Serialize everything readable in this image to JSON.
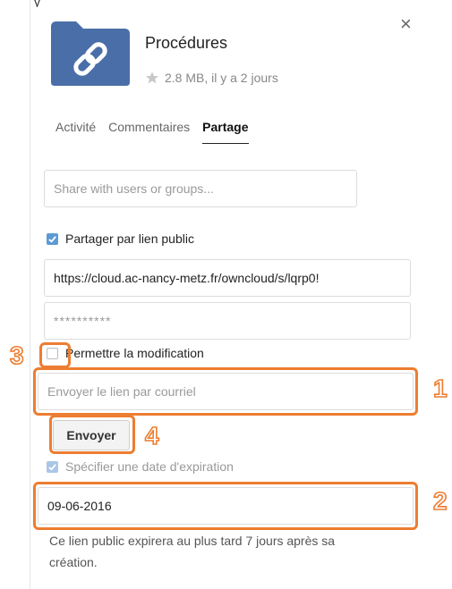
{
  "header": {
    "top_fragment": "y",
    "title": "Procédures",
    "meta": "2.8 MB, il y a 2 jours",
    "close_symbol": "×"
  },
  "tabs": [
    {
      "label": "Activité",
      "active": false
    },
    {
      "label": "Commentaires",
      "active": false
    },
    {
      "label": "Partage",
      "active": true
    }
  ],
  "share": {
    "search_placeholder": "Share with users or groups...",
    "public_link_label": "Partager par lien public",
    "public_link_checked": true,
    "link_url": "https://cloud.ac-nancy-metz.fr/owncloud/s/lqrp0!",
    "password_value": "**********",
    "allow_edit_label": "Permettre la modification",
    "allow_edit_checked": false,
    "email_placeholder": "Envoyer le lien par courriel",
    "send_label": "Envoyer",
    "expire_label": "Spécifier une date d'expiration",
    "expire_checked": true,
    "expire_date": "09-06-2016",
    "expire_note": "Ce lien public expirera au plus tard 7 jours après sa création."
  },
  "annotations": {
    "n1": "1",
    "n2": "2",
    "n3": "3",
    "n4": "4",
    "color": "#ed7d31"
  },
  "colors": {
    "folder": "#4a6ea8",
    "checkbox": "#5b9bd5"
  }
}
